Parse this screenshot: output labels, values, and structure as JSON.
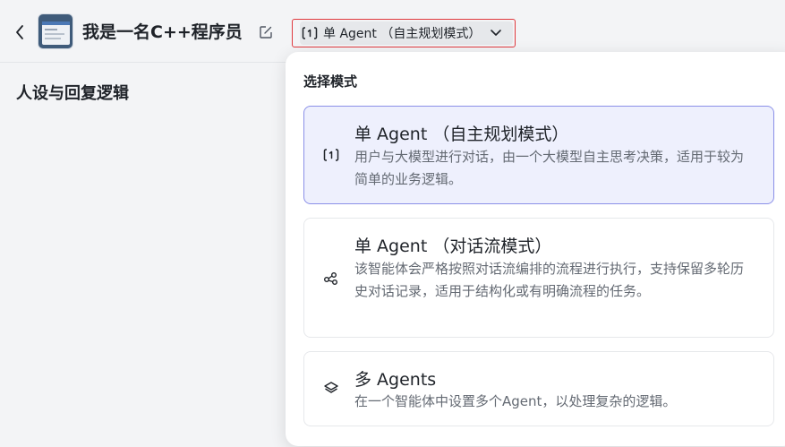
{
  "header": {
    "title": "我是一名C++程序员",
    "mode_selector_label": "单 Agent （自主规划模式）"
  },
  "left_panel": {
    "section_title": "人设与回复逻辑"
  },
  "dropdown": {
    "title": "选择模式",
    "options": [
      {
        "name": "单 Agent （自主规划模式）",
        "description": "用户与大模型进行对话，由一个大模型自主思考决策，适用于较为简单的业务逻辑。",
        "icon": "single-agent-icon",
        "selected": true
      },
      {
        "name": "单 Agent （对话流模式）",
        "description": "该智能体会严格按照对话流编排的流程进行执行，支持保留多轮历史对话记录，适用于结构化或有明确流程的任务。",
        "icon": "workflow-icon",
        "selected": false
      },
      {
        "name": "多 Agents",
        "description": "在一个智能体中设置多个Agent，以处理复杂的逻辑。",
        "icon": "layers-icon",
        "selected": false
      }
    ]
  },
  "colors": {
    "selected_bg": "#eef0fd",
    "selected_border": "#8b90e8",
    "highlight_border": "#e0393e"
  }
}
